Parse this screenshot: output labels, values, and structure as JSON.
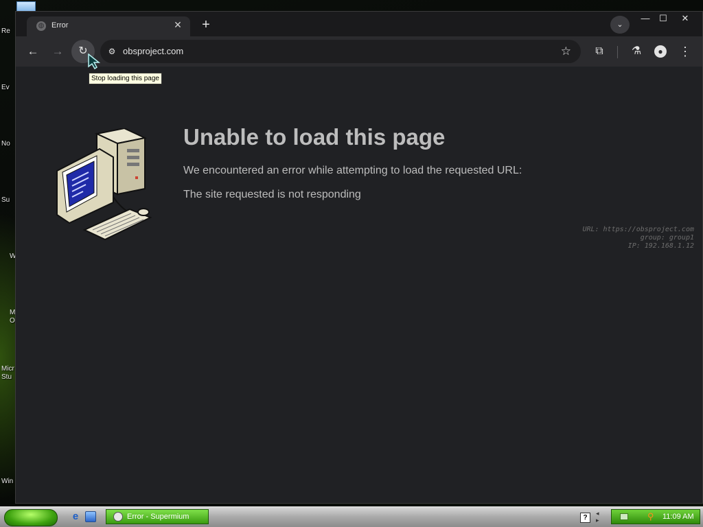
{
  "desktop": {
    "icon_labels": [
      "Re",
      "Ev",
      "No",
      "Su",
      "W",
      "M\nO",
      "Micr\nStu",
      "Win"
    ]
  },
  "browser": {
    "tab": {
      "title": "Error",
      "favicon": "globe-icon",
      "close": "✕"
    },
    "new_tab": "+",
    "tab_search": "⌄",
    "window_controls": {
      "minimize": "—",
      "maximize": "☐",
      "close": "✕"
    },
    "toolbar": {
      "back": "←",
      "forward": "→",
      "reload": "↻",
      "url": "obsproject.com",
      "bookmark": "☆",
      "extensions": "⧉",
      "labs": "⚗",
      "profile": "●",
      "menu": "⋮"
    },
    "tooltip": "Stop loading this page"
  },
  "error_page": {
    "title": "Unable to load this page",
    "description": "We encountered an error while attempting to load the requested URL:",
    "reason": "The site requested is not responding",
    "diagnostics": [
      "URL: https://obsproject.com",
      "group: group1",
      "IP: 192.168.1.12"
    ]
  },
  "taskbar": {
    "task_item": "Error - Supermium",
    "help": "?",
    "clock": "11:09 AM"
  },
  "colors": {
    "browser_bg": "#202124",
    "toolbar_bg": "#2b2b2e",
    "text": "#bdbdbd",
    "start_green": "#3fa310"
  }
}
